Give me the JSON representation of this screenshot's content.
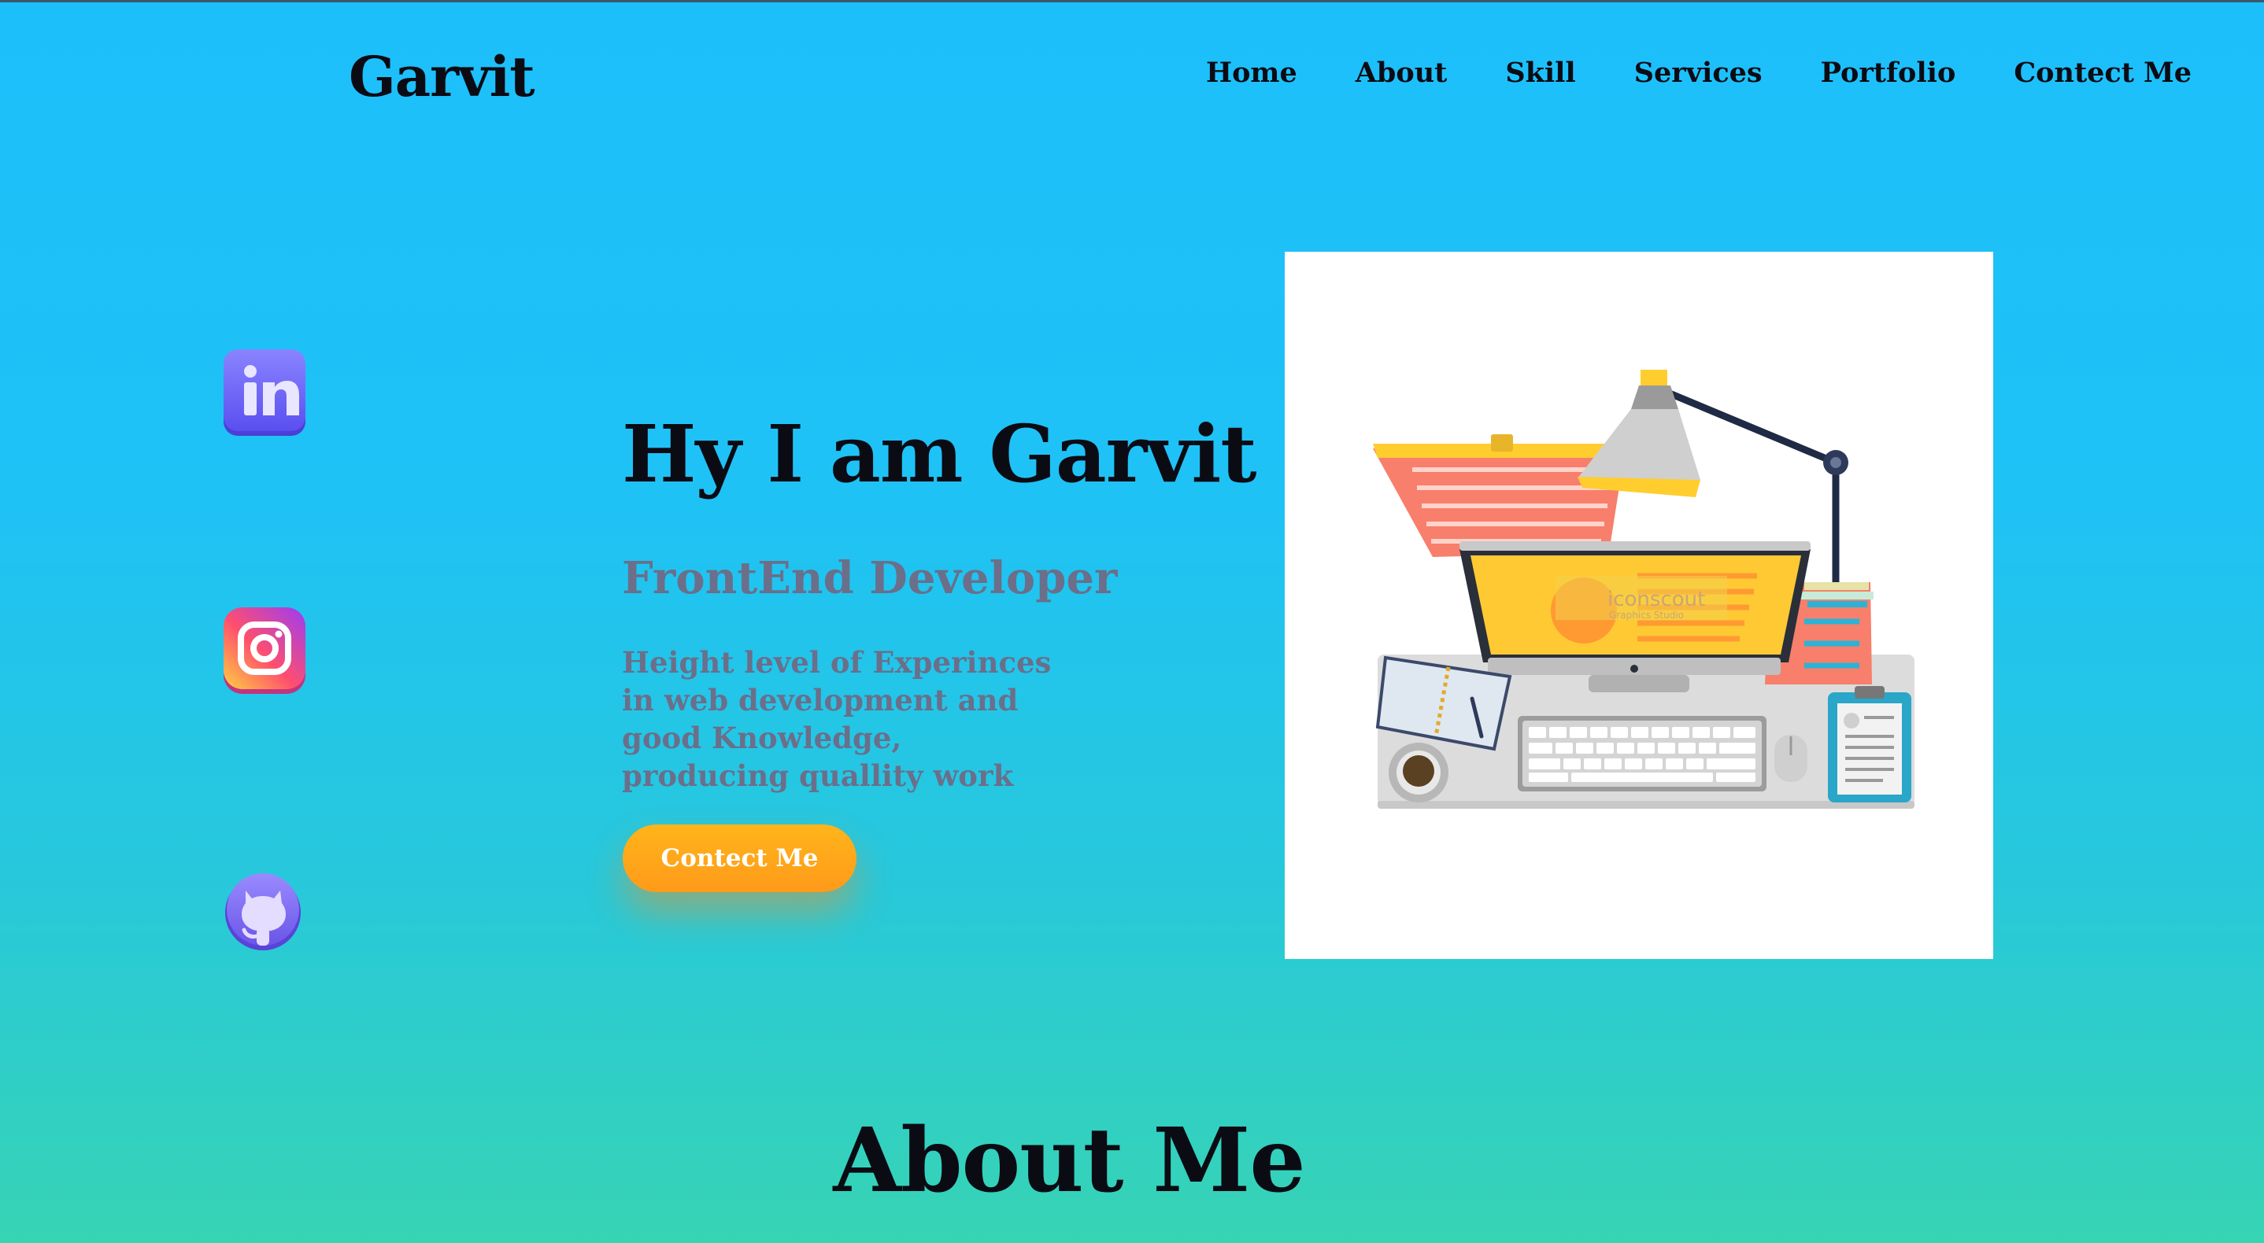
{
  "header": {
    "logo": "Garvit",
    "nav": [
      "Home",
      "About",
      "Skill",
      "Services",
      "Portfolio",
      "Contect Me"
    ]
  },
  "social": [
    {
      "name": "linkedin-icon",
      "label": "in",
      "color": "#6b63ff"
    },
    {
      "name": "instagram-icon",
      "color": "#e1306c"
    },
    {
      "name": "github-icon",
      "color": "#8f7cff"
    }
  ],
  "hero": {
    "title": "Hy I am Garvit",
    "subtitle": "FrontEnd Developer",
    "description": "Height level of Experinces in web development and good Knowledge, producing quallity work",
    "cta": "Contect Me",
    "image_watermark": "iconscout",
    "image_watermark_sub": "Graphics Studio"
  },
  "about": {
    "title": "About Me"
  },
  "colors": {
    "background_top": "#1dbffb",
    "background_bottom": "#37d4b4",
    "accent": "#ffa81a",
    "muted_text": "#6b6f8a"
  }
}
